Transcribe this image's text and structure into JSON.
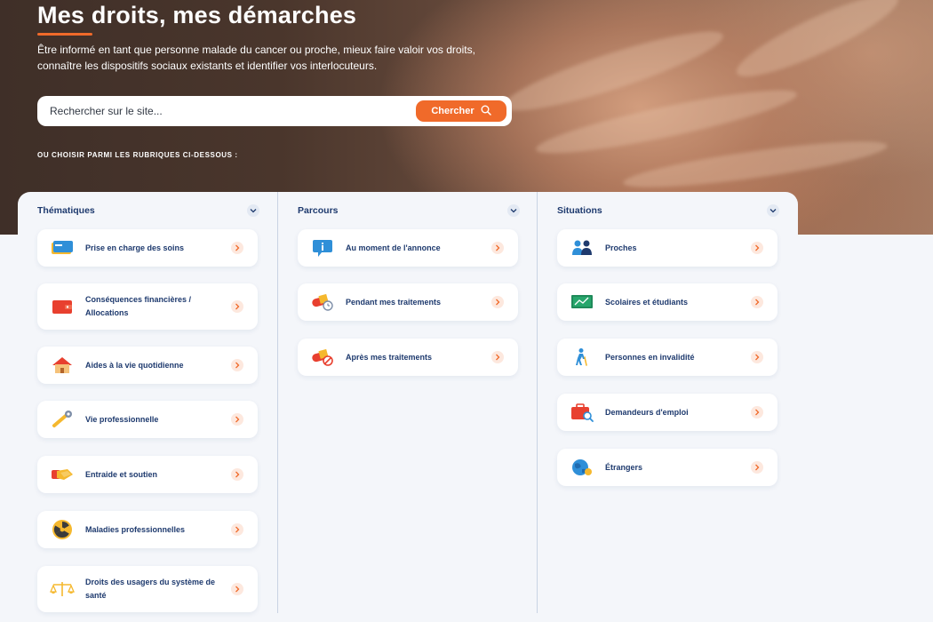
{
  "hero": {
    "title": "Mes droits, mes démarches",
    "description": "Être informé en tant que personne malade du cancer ou proche, mieux faire valoir vos droits, connaître les dispositifs sociaux existants et identifier vos interlocuteurs.",
    "subheading": "OU CHOISIR PARMI LES RUBRIQUES CI-DESSOUS :"
  },
  "search": {
    "placeholder": "Rechercher sur le site...",
    "button_label": "Chercher"
  },
  "colors": {
    "accent": "#f06a2a",
    "text_dark_blue": "#1e3a6e",
    "panel_bg": "#f4f6fa"
  },
  "columns": [
    {
      "title": "Thématiques",
      "items": [
        {
          "label": "Prise en charge des soins",
          "icon": "health-card-icon"
        },
        {
          "label": "Conséquences financières / Allocations",
          "icon": "wallet-icon"
        },
        {
          "label": "Aides à la vie quotidienne",
          "icon": "house-icon"
        },
        {
          "label": "Vie professionnelle",
          "icon": "wrench-icon"
        },
        {
          "label": "Entraide et soutien",
          "icon": "handshake-icon"
        },
        {
          "label": "Maladies professionnelles",
          "icon": "radiation-icon"
        },
        {
          "label": "Droits des usagers du système de santé",
          "icon": "scales-icon"
        }
      ]
    },
    {
      "title": "Parcours",
      "items": [
        {
          "label": "Au moment de l'annonce",
          "icon": "info-bubble-icon"
        },
        {
          "label": "Pendant mes traitements",
          "icon": "pill-clock-icon"
        },
        {
          "label": "Après mes traitements",
          "icon": "pill-cancel-icon"
        }
      ]
    },
    {
      "title": "Situations",
      "items": [
        {
          "label": "Proches",
          "icon": "people-icon"
        },
        {
          "label": "Scolaires et étudiants",
          "icon": "chalkboard-icon"
        },
        {
          "label": "Personnes en invalidité",
          "icon": "person-cane-icon"
        },
        {
          "label": "Demandeurs d'emploi",
          "icon": "briefcase-search-icon"
        },
        {
          "label": "Étrangers",
          "icon": "globe-icon"
        }
      ]
    }
  ]
}
